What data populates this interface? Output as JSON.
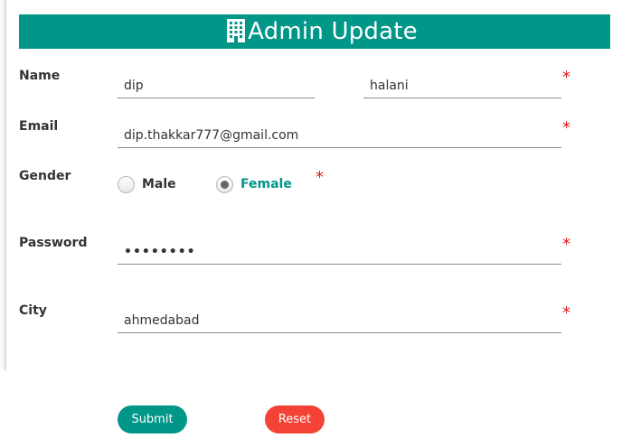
{
  "header": {
    "title": "Admin Update",
    "icon": "building-icon"
  },
  "form": {
    "name": {
      "label": "Name",
      "first_value": "dip",
      "last_value": "halani",
      "required": "*"
    },
    "email": {
      "label": "Email",
      "value": "dip.thakkar777@gmail.com",
      "required": "*"
    },
    "gender": {
      "label": "Gender",
      "options": [
        "Male",
        "Female"
      ],
      "selected": "Female",
      "required": "*"
    },
    "password": {
      "label": "Password",
      "value": "••••••••",
      "required": "*"
    },
    "city": {
      "label": "City",
      "value": "ahmedabad",
      "required": "*"
    }
  },
  "buttons": {
    "submit": "Submit",
    "reset": "Reset"
  },
  "colors": {
    "accent": "#009688",
    "reset": "#f44336",
    "required": "#e31b1b"
  }
}
